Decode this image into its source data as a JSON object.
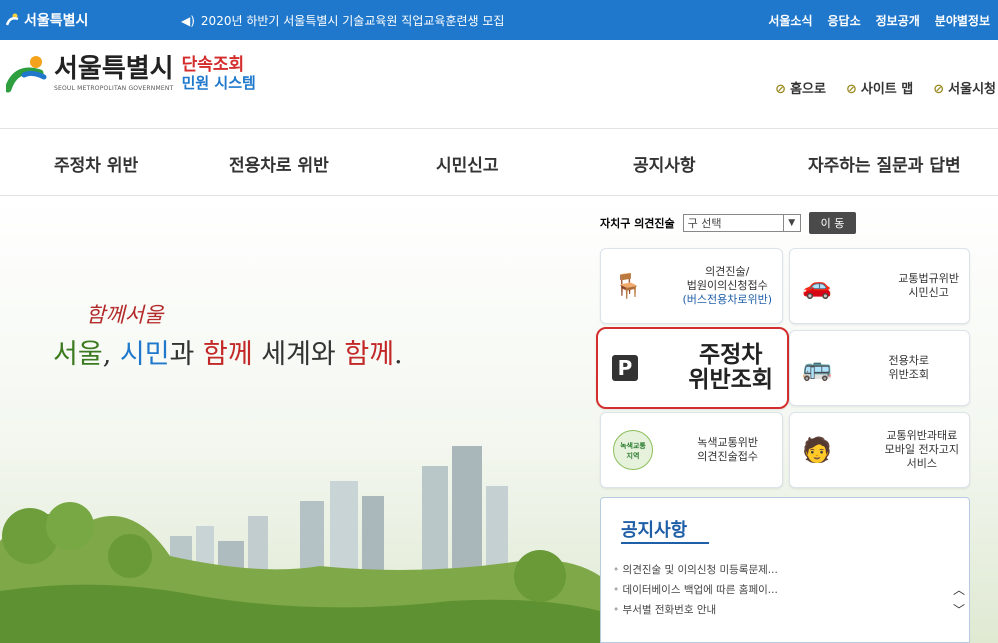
{
  "topbar": {
    "home": "서울특별시",
    "notice": "2020년 하반기 서울특별시 기술교육원 직업교육훈련생 모집",
    "links": [
      "서울소식",
      "응답소",
      "정보공개",
      "분야별정보"
    ]
  },
  "header": {
    "logo_name": "서울특별시",
    "logo_sub": "SEOUL METROPOLITAN GOVERNMENT",
    "system_line1": "단속조회",
    "system_line2": "민원 시스템",
    "util": [
      "홈으로",
      "사이트 맵",
      "서울시청"
    ]
  },
  "nav": [
    "주정차 위반",
    "전용차로 위반",
    "시민신고",
    "공지사항",
    "자주하는 질문과 답변"
  ],
  "hero": {
    "slogan1": "함께서울",
    "slogan2_parts": [
      "서울",
      ", ",
      "시민",
      "과 ",
      "함께",
      " 세계와 ",
      "함께",
      "."
    ]
  },
  "opinion": {
    "label": "자치구 의견진술",
    "select_value": "구 선택",
    "go": "이 동"
  },
  "cards": {
    "c1": [
      "의견진술/",
      "법원이의신청접수",
      "(버스전용차로위반)"
    ],
    "c2": [
      "교통법규위반",
      "시민신고"
    ],
    "c3": [
      "주정차",
      "위반조회"
    ],
    "c4": [
      "전용차로",
      "위반조회"
    ],
    "c5": [
      "녹색교통위반",
      "의견진술접수"
    ],
    "c5_badge": [
      "녹색교통",
      "지역"
    ],
    "c6": [
      "교통위반과태료",
      "모바일 전자고지",
      "서비스"
    ]
  },
  "notices": {
    "title": "공지사항",
    "items": [
      "의견진술 및 이의신청 미등록문제...",
      "데이터베이스 백업에 따른 홈페이...",
      "부서별 전화번호 안내"
    ]
  }
}
